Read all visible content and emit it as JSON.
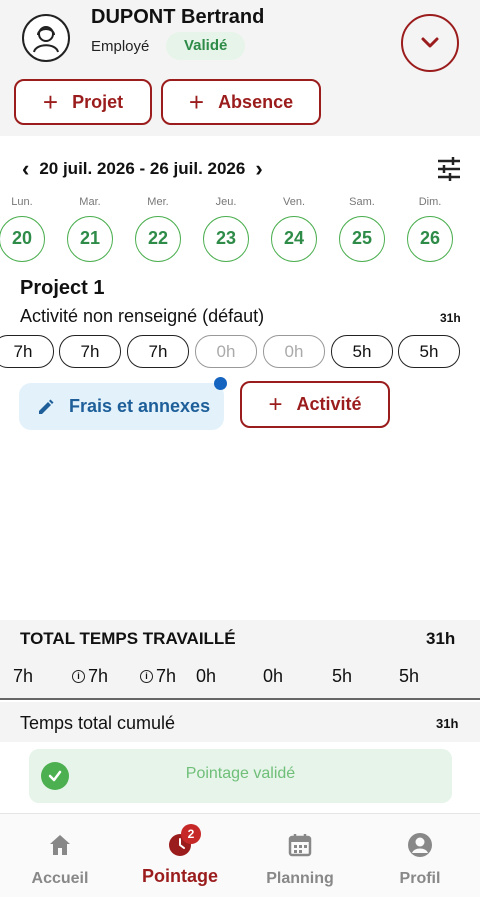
{
  "user": {
    "name": "DUPONT Bertrand",
    "role": "Employé",
    "status": "Validé"
  },
  "actions": {
    "projet_label": "Projet",
    "absence_label": "Absence"
  },
  "week": {
    "range": "20 juil. 2026 - 26 juil. 2026"
  },
  "days": [
    {
      "name": "Lun.",
      "num": "20"
    },
    {
      "name": "Mar.",
      "num": "21"
    },
    {
      "name": "Mer.",
      "num": "22"
    },
    {
      "name": "Jeu.",
      "num": "23"
    },
    {
      "name": "Ven.",
      "num": "24"
    },
    {
      "name": "Sam.",
      "num": "25"
    },
    {
      "name": "Dim.",
      "num": "26"
    }
  ],
  "project": {
    "title": "Project 1",
    "activity": "Activité non renseigné (défaut)",
    "activity_total": "31h",
    "hours": [
      "7h",
      "7h",
      "7h",
      "0h",
      "0h",
      "5h",
      "5h"
    ]
  },
  "buttons": {
    "frais": "Frais et annexes",
    "activite": "Activité"
  },
  "totals": {
    "label": "TOTAL TEMPS TRAVAILLÉ",
    "value": "31h",
    "days": [
      "7h",
      "7h",
      "7h",
      "0h",
      "0h",
      "5h",
      "5h"
    ],
    "cumul_label": "Temps total cumulé",
    "cumul_value": "31h"
  },
  "banner": {
    "text": "Pointage validé"
  },
  "nav": {
    "accueil": "Accueil",
    "pointage": "Pointage",
    "pointage_badge": "2",
    "planning": "Planning",
    "profil": "Profil"
  },
  "colors": {
    "accent": "#9b1c1c",
    "success": "#4caf50",
    "info": "#1e5f99"
  }
}
